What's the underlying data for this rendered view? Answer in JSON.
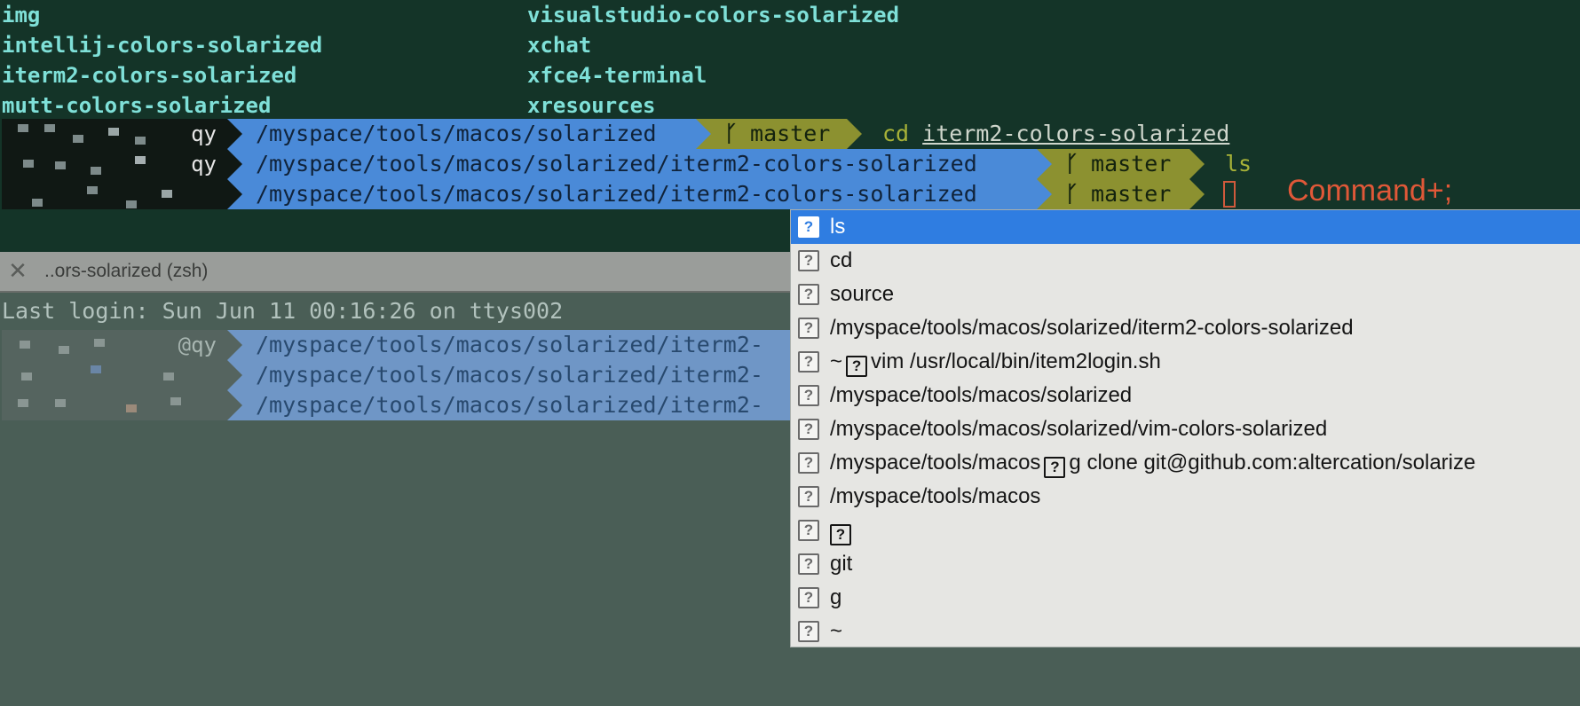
{
  "ls_output": {
    "left": [
      "img",
      "intellij-colors-solarized",
      "iterm2-colors-solarized",
      "mutt-colors-solarized"
    ],
    "right": [
      "visualstudio-colors-solarized",
      "xchat",
      "xfce4-terminal",
      "xresources"
    ]
  },
  "prompts": [
    {
      "user": "qy",
      "path": "/myspace/tools/macos/solarized",
      "branch": "master",
      "command": "cd",
      "arg": "iterm2-colors-solarized"
    },
    {
      "user": "qy",
      "path": "/myspace/tools/macos/solarized/iterm2-colors-solarized",
      "branch": "master",
      "command": "ls",
      "arg": ""
    },
    {
      "user": "",
      "path": "/myspace/tools/macos/solarized/iterm2-colors-solarized",
      "branch": "master",
      "command": "",
      "arg": ""
    }
  ],
  "shortcut_hint": "Command+;",
  "tab": {
    "close_icon": "close-icon",
    "title": "..ors-solarized (zsh)"
  },
  "bottom": {
    "last_login": "Last login: Sun Jun 11 00:16:26 on ttys002",
    "prompts": [
      {
        "user": "@qy",
        "path": "/myspace/tools/macos/solarized/iterm2-"
      },
      {
        "user": "",
        "path": "/myspace/tools/macos/solarized/iterm2-"
      },
      {
        "user": "",
        "path": "/myspace/tools/macos/solarized/iterm2-"
      }
    ]
  },
  "autocomplete": {
    "selected_index": 0,
    "items": [
      {
        "pre": "ls"
      },
      {
        "pre": "cd"
      },
      {
        "pre": "source"
      },
      {
        "pre": "/myspace/tools/macos/solarized/iterm2-colors-solarized"
      },
      {
        "pre": " ~",
        "post": "vim /usr/local/bin/item2login.sh"
      },
      {
        "pre": "/myspace/tools/macos/solarized"
      },
      {
        "pre": "/myspace/tools/macos/solarized/vim-colors-solarized"
      },
      {
        "pre": " /myspace/tools/macos",
        "post": "g clone git@github.com:altercation/solarize"
      },
      {
        "pre": "/myspace/tools/macos"
      },
      {
        "pre": "",
        "post": ""
      },
      {
        "pre": "git"
      },
      {
        "pre": "g"
      },
      {
        "pre": "~"
      }
    ]
  },
  "colors": {
    "top_bg": "#143428",
    "bottom_bg": "#4a5e56",
    "path_blue": "#4a8ad8",
    "git_olive": "#8c9130",
    "selection_blue": "#2f7de1",
    "hint_orange": "#e05838"
  }
}
